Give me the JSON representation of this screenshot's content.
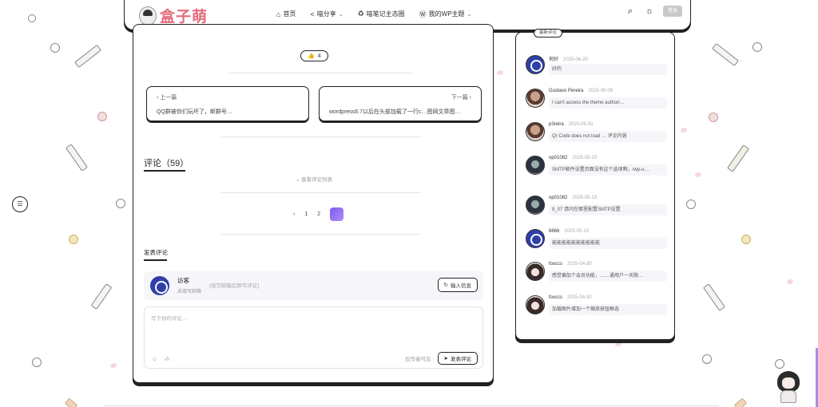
{
  "header": {
    "logo_text": "盒子萌",
    "nav": [
      {
        "label": "首页",
        "icon": "home-icon",
        "glyph": "⌂",
        "has_dropdown": false
      },
      {
        "label": "喵分享",
        "icon": "share-icon",
        "glyph": "<",
        "has_dropdown": true
      },
      {
        "label": "喵笔记主态圈",
        "icon": "recycle-icon",
        "glyph": "♻",
        "has_dropdown": false
      },
      {
        "label": "我的WP主题",
        "icon": "wordpress-icon",
        "glyph": "Ⓦ",
        "has_dropdown": true
      }
    ],
    "login_label": "登录"
  },
  "post": {
    "likes": "4",
    "prev_dir": "上一篇",
    "prev_title": "QQ群被你们玩坏了，断群号…",
    "next_dir": "下一篇",
    "next_title": "wordpress6.7以后在头部加载了一行c…图网文章图…"
  },
  "comments": {
    "title": "评论（59）",
    "view_list": "查看评论列表",
    "pages": [
      "1",
      "2"
    ],
    "write_title": "发表评论",
    "visitor_name": "访客",
    "visitor_sub": "未填写邮箱",
    "visitor_hint": "[填写邮箱后即可评论]",
    "fill_info": "输入信息",
    "placeholder": "写下你的评论...",
    "members_only": "仅作者可见",
    "submit": "发表评论"
  },
  "sidebar": {
    "label": "最新评论",
    "items": [
      {
        "name": "何好",
        "date": "2025-06-20",
        "text": "好的",
        "avatar": "logo"
      },
      {
        "name": "Gustavo Pereira",
        "date": "2025-06-08",
        "text": "I can't access the theme authori…",
        "avatar": "photo"
      },
      {
        "name": "p3reira",
        "date": "2025-06-03",
        "text": "Qr Code does not load … 评论内容",
        "avatar": "photo"
      },
      {
        "name": "op01082",
        "date": "2025-05-15",
        "text": "SMTP邮件设置页面没有这个选项啊，/wp-o…",
        "avatar": "dark"
      },
      {
        "name": "op01082",
        "date": "2025-05-13",
        "text": "9_07 请问在哪里配置SMTP设置",
        "avatar": "dark"
      },
      {
        "name": "6666",
        "date": "2025-05-10",
        "text": "能能能能能能能能能能",
        "avatar": "logo"
      },
      {
        "name": "foxccs",
        "date": "2025-04-30",
        "text": "感觉偏加个会员功能，……通用户一天限…",
        "avatar": "anime"
      },
      {
        "name": "foxccs",
        "date": "2025-04-30",
        "text": "加载图片增加一个缩放按钮框选",
        "avatar": "anime"
      }
    ]
  }
}
